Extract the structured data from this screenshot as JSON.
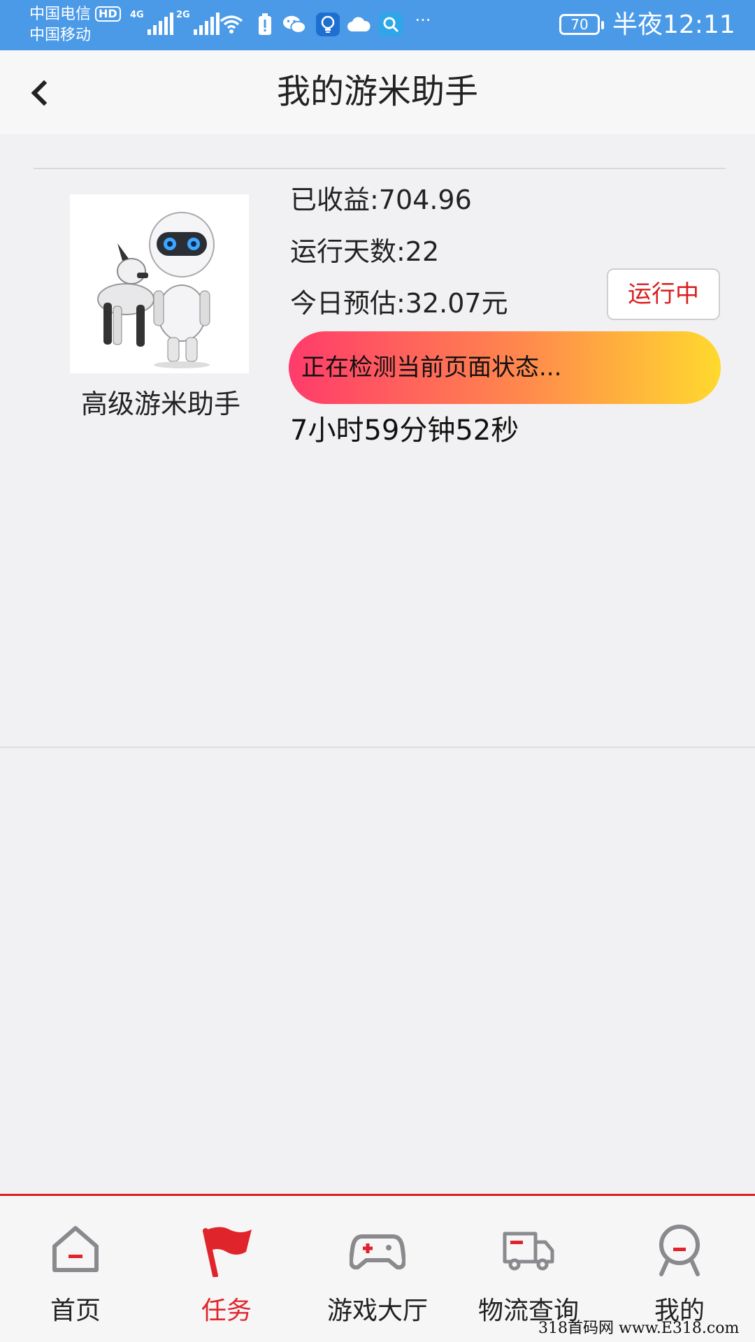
{
  "status_bar": {
    "carrier_1": "中国电信",
    "hd_badge": "HD",
    "carrier_2": "中国移动",
    "signal_1_gen": "4G",
    "signal_2_gen": "2G",
    "more": "···",
    "battery": "70",
    "time": "半夜12:11",
    "icons": [
      "signal-icon",
      "wifi-icon",
      "battery-saver-icon",
      "wechat-icon",
      "bulb-icon",
      "cloud-icon",
      "search-icon"
    ]
  },
  "header": {
    "title": "我的游米助手"
  },
  "assistant": {
    "name": "高级游米助手",
    "earned": "已收益:704.96",
    "days": "运行天数:22",
    "today_estimate": "今日预估:32.07元",
    "status_button": "运行中",
    "progress_text": "正在检测当前页面状态...",
    "runtime": "7小时59分钟52秒"
  },
  "tabs": [
    {
      "label": "首页",
      "icon": "home-icon",
      "active": false
    },
    {
      "label": "任务",
      "icon": "flag-icon",
      "active": true
    },
    {
      "label": "游戏大厅",
      "icon": "gamepad-icon",
      "active": false
    },
    {
      "label": "物流查询",
      "icon": "truck-icon",
      "active": false
    },
    {
      "label": "我的",
      "icon": "user-icon",
      "active": false
    }
  ],
  "watermark": "318首码网 www.E318.com",
  "colors": {
    "status_bar": "#4a9ae8",
    "accent_red": "#e0242b",
    "gradient_start": "#ff3b6b",
    "gradient_end": "#ffd92e"
  }
}
